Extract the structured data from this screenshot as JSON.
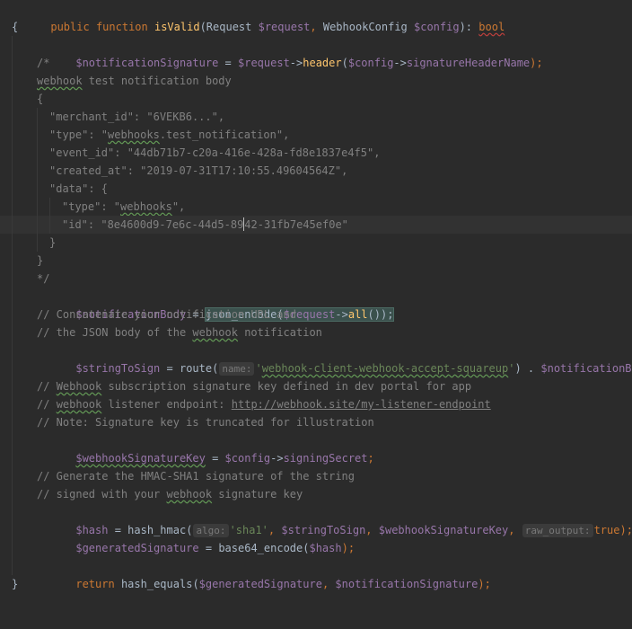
{
  "editor": {
    "sig": {
      "public": "public",
      "function": "function",
      "name": "isValid",
      "open": "(",
      "type1": "Request ",
      "param1": "$request",
      "comma": ", ",
      "type2": "WebhookConfig ",
      "param2": "$config",
      "close": "): ",
      "ret": "bool"
    },
    "brace_open": "{",
    "brace_close": "}",
    "l3": {
      "var": "$notificationSignature",
      "eq": " = ",
      "obj": "$request",
      "arrow": "->",
      "method": "header",
      "p": "(",
      "arg": "$config",
      "arrow2": "->",
      "prop": "signatureHeaderName",
      "end": ");"
    },
    "comment_block": {
      "open": "/*",
      "l5_a": "webhook",
      "l5_b": " test notification body",
      "l6": "{",
      "l7": "\"merchant_id\": \"6VEKB6...\",",
      "l8_a": "\"type\": \"",
      "l8_b": "webhooks",
      "l8_c": ".test_notification\",",
      "l9": "\"event_id\": \"44db71b7-c20a-416e-428a-fd8e1837e4f5\",",
      "l10": "\"created_at\": \"2019-07-31T17:10:55.49604564Z\",",
      "l11": "\"data\": {",
      "l12_a": "\"type\": \"",
      "l12_b": "webhooks",
      "l12_c": "\",",
      "l13_a": "\"id\": \"8e4600d9-7e6c-44d5-89",
      "l13_b": "42-31fb7e45ef0e\"",
      "l14": "}",
      "l15": "}",
      "close": "*/"
    },
    "l17": {
      "var": "$notificationBody",
      "eq": " = ",
      "fn": "json_encode",
      "p": "(",
      "obj": "$request",
      "arrow": "->",
      "method": "all",
      "end": "());"
    },
    "l18": "// Concatenate your notification URL and",
    "l19_a": "// the JSON body of the ",
    "l19_b": "webhook",
    "l19_c": " notification",
    "l20": {
      "var": "$stringToSign",
      "eq": " = ",
      "fn": "route",
      "p": "(",
      "hint": "name:",
      "str_a": "'",
      "str_b": "webhook-client-webhook-accept-squareup",
      "str_c": "'",
      "end": ") . ",
      "var2": "$notificationBody",
      "semi": ";"
    },
    "l22_a": "// ",
    "l22_b": "Webhook",
    "l22_c": " subscription signature key defined in dev portal for app",
    "l23_a": "// ",
    "l23_b": "webhook",
    "l23_c": " listener endpoint: ",
    "l23_url": "http://webhook.site/my-listener-endpoint",
    "l24": "// Note: Signature key is truncated for illustration",
    "l25": {
      "var": "$webhookSignatureKey",
      "eq": " = ",
      "obj": "$config",
      "arrow": "->",
      "prop": "signingSecret",
      "semi": ";"
    },
    "l27": "// Generate the HMAC-SHA1 signature of the string",
    "l28_a": "// signed with your ",
    "l28_b": "webhook",
    "l28_c": " signature key",
    "l29": {
      "var": "$hash",
      "eq": " = ",
      "fn": "hash_hmac",
      "p": "(",
      "hint1": "algo:",
      "str1": "'sha1'",
      "c1": ", ",
      "arg2": "$stringToSign",
      "c2": ", ",
      "arg3": "$webhookSignatureKey",
      "c3": ", ",
      "hint2": "raw_output:",
      "val": "true",
      "end": ");"
    },
    "l30": {
      "var": "$generatedSignature",
      "eq": " = ",
      "fn": "base64_encode",
      "p": "(",
      "arg": "$hash",
      "end": ");"
    },
    "l32": {
      "kw": "return",
      "sp": " ",
      "fn": "hash_equals",
      "p": "(",
      "a1": "$generatedSignature",
      "c": ", ",
      "a2": "$notificationSignature",
      "end": ");"
    }
  }
}
